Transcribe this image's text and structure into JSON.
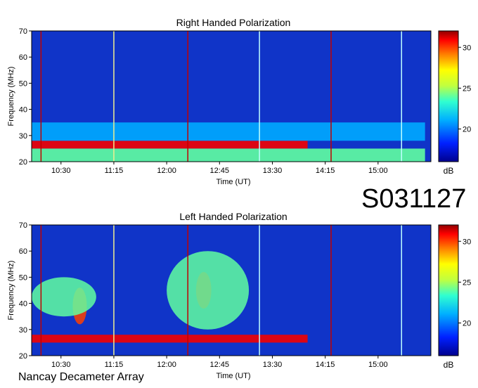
{
  "observation_id": "S031127",
  "instrument": "Nancay Decameter Array",
  "colors": {
    "spectrum_background": "#1034c8",
    "burst_band": "#a00000",
    "marker_red": "#c00000",
    "marker_yellow": "#f0f090",
    "marker_cyan": "#c0ffff"
  },
  "chart_data": [
    {
      "type": "heatmap",
      "title": "Right Handed Polarization",
      "xlabel": "Time (UT)",
      "ylabel": "Frequency (MHz)",
      "x_ticks": [
        "10:30",
        "11:15",
        "12:00",
        "12:45",
        "13:30",
        "14:15",
        "15:00"
      ],
      "y_ticks": [
        20,
        30,
        40,
        50,
        60,
        70
      ],
      "ylim": [
        20,
        70
      ],
      "colorbar": {
        "label": "dB",
        "ticks": [
          20,
          25,
          30
        ],
        "range": [
          16,
          32
        ]
      },
      "features": [
        {
          "freq_range_mhz": [
            25,
            28
          ],
          "time_range": [
            "10:05",
            "14:00"
          ],
          "level_db": 31
        },
        {
          "freq_range_mhz": [
            20,
            25
          ],
          "time_range": [
            "10:05",
            "15:40"
          ],
          "level_db": 24
        },
        {
          "freq_range_mhz": [
            28,
            35
          ],
          "time_range": [
            "10:05",
            "15:40"
          ],
          "level_db": 21
        }
      ],
      "markers": [
        {
          "time": "10:13",
          "color": "red"
        },
        {
          "time": "11:15",
          "color": "yellow"
        },
        {
          "time": "12:18",
          "color": "red"
        },
        {
          "time": "13:19",
          "color": "cyan"
        },
        {
          "time": "14:20",
          "color": "red"
        },
        {
          "time": "15:20",
          "color": "cyan"
        }
      ]
    },
    {
      "type": "heatmap",
      "title": "Left Handed Polarization",
      "xlabel": "Time (UT)",
      "ylabel": "Frequency (MHz)",
      "x_ticks": [
        "10:30",
        "11:15",
        "12:00",
        "12:45",
        "13:30",
        "14:15",
        "15:00"
      ],
      "y_ticks": [
        20,
        30,
        40,
        50,
        60,
        70
      ],
      "ylim": [
        20,
        70
      ],
      "colorbar": {
        "label": "dB",
        "ticks": [
          20,
          25,
          30
        ],
        "range": [
          16,
          32
        ]
      },
      "features": [
        {
          "freq_range_mhz": [
            25,
            28
          ],
          "time_range": [
            "10:05",
            "14:00"
          ],
          "level_db": 31
        },
        {
          "freq_range_mhz": [
            32,
            46
          ],
          "time_range": [
            "10:40",
            "10:52"
          ],
          "level_db": 30
        },
        {
          "freq_range_mhz": [
            38,
            52
          ],
          "time_range": [
            "12:25",
            "12:38"
          ],
          "level_db": 31
        },
        {
          "freq_range_mhz": [
            30,
            60
          ],
          "time_range": [
            "12:00",
            "13:10"
          ],
          "level_db": 24
        },
        {
          "freq_range_mhz": [
            35,
            50
          ],
          "time_range": [
            "10:05",
            "11:00"
          ],
          "level_db": 24
        }
      ],
      "markers": [
        {
          "time": "10:13",
          "color": "red"
        },
        {
          "time": "11:15",
          "color": "yellow"
        },
        {
          "time": "12:18",
          "color": "red"
        },
        {
          "time": "13:19",
          "color": "cyan"
        },
        {
          "time": "14:20",
          "color": "red"
        },
        {
          "time": "15:20",
          "color": "cyan"
        }
      ]
    }
  ]
}
